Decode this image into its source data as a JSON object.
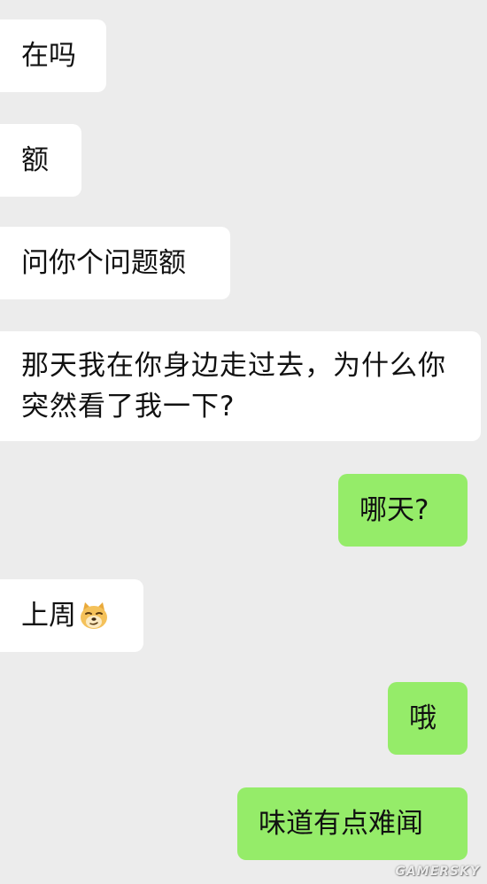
{
  "chat": {
    "messages": [
      {
        "side": "received",
        "text": "在吗"
      },
      {
        "side": "received",
        "text": "额"
      },
      {
        "side": "received",
        "text": "问你个问题额"
      },
      {
        "side": "received",
        "text": "那天我在你身边走过去，为什么你突然看了我一下?"
      },
      {
        "side": "sent",
        "text": "哪天?"
      },
      {
        "side": "received",
        "text": "上周",
        "emoji": "doge-emoji"
      },
      {
        "side": "sent",
        "text": "哦"
      },
      {
        "side": "sent",
        "text": "味道有点难闻"
      }
    ]
  },
  "watermark": "GAMERSKY",
  "colors": {
    "background": "#ececec",
    "received_bubble": "#ffffff",
    "sent_bubble": "#95ec69",
    "text": "#111111"
  }
}
